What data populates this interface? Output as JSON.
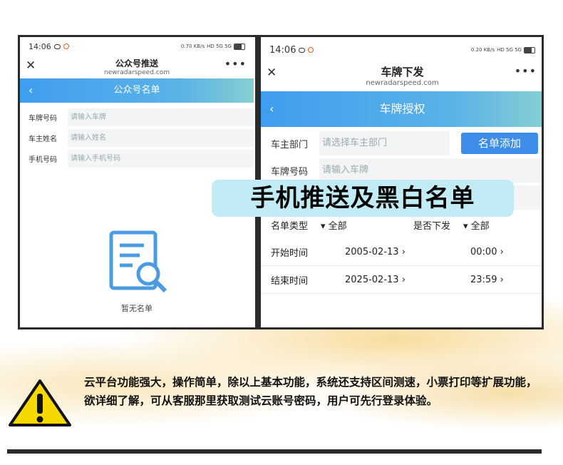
{
  "phone1": {
    "time": "14:06",
    "net_speed": "0.70 KB/s",
    "title": "公众号推送",
    "url": "newradarspeed.com",
    "nav_title": "公众号名单",
    "fields": [
      {
        "label": "车牌号码",
        "placeholder": "请输入车牌"
      },
      {
        "label": "车主姓名",
        "placeholder": "请输入姓名"
      },
      {
        "label": "手机号码",
        "placeholder": "请输入手机号码"
      }
    ],
    "empty_text": "暂无名单"
  },
  "phone2": {
    "time": "14:06",
    "net_speed": "0.20 KB/s",
    "title": "车牌下发",
    "url": "newradarspeed.com",
    "nav_title": "车牌授权",
    "owner_dept_label": "车主部门",
    "owner_dept_placeholder": "请选择车主部门",
    "add_button": "名单添加",
    "plate_label": "车牌号码",
    "plate_placeholder": "请输入车牌",
    "list_type_label": "名单类型",
    "list_type_value": "全部",
    "issued_label": "是否下发",
    "issued_value": "全部",
    "start_label": "开始时间",
    "start_date": "2005-02-13",
    "start_time": "00:00",
    "end_label": "结束时间",
    "end_date": "2025-02-13",
    "end_time": "23:59"
  },
  "banner": "手机推送及黑白名单",
  "note": "云平台功能强大，操作简单，除以上基本功能，系统还支持区间测速，小票打印等扩展功能，欲详细了解，可从客服那里获取测试云账号密码，用户可先行登录体验。",
  "colors": {
    "accent": "#3e8ee9",
    "banner_bg": "#c2ecf5",
    "warning": "#f5d800"
  }
}
